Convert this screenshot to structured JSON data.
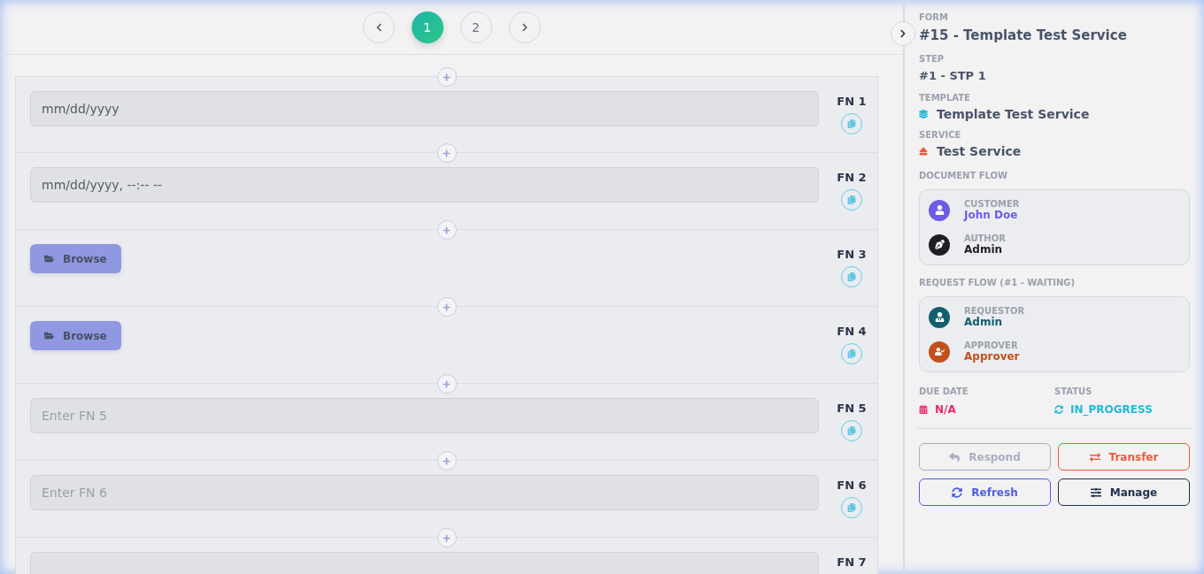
{
  "pagination": {
    "pages": [
      {
        "label": "1",
        "selected": true
      },
      {
        "label": "2",
        "selected": false
      }
    ]
  },
  "fields": [
    {
      "label": "FN 1",
      "kind": "date",
      "placeholder": "mm/dd/yyyy"
    },
    {
      "label": "FN 2",
      "kind": "datetime",
      "placeholder": "mm/dd/yyyy, --:-- --"
    },
    {
      "label": "FN 3",
      "kind": "file",
      "button": "Browse"
    },
    {
      "label": "FN 4",
      "kind": "file",
      "button": "Browse"
    },
    {
      "label": "FN 5",
      "kind": "text",
      "placeholder": "Enter FN 5"
    },
    {
      "label": "FN 6",
      "kind": "text",
      "placeholder": "Enter FN 6"
    },
    {
      "label": "FN 7",
      "kind": "text"
    }
  ],
  "details": {
    "form_label": "FORM",
    "form": "#15 - Template Test Service",
    "step_label": "STEP",
    "step": "#1 - STP 1",
    "template_label": "TEMPLATE",
    "template": "Template Test Service",
    "service_label": "SERVICE",
    "service": "Test Service",
    "document_flow": {
      "title": "DOCUMENT FLOW",
      "people": [
        {
          "kind": "customer",
          "role": "CUSTOMER",
          "name": "John Doe",
          "color": "#6c5ce7"
        },
        {
          "kind": "author",
          "role": "AUTHOR",
          "name": "Admin",
          "color": "#1e1e24"
        }
      ]
    },
    "request_flow": {
      "title": "REQUEST FLOW (#1 - WAITING)",
      "people": [
        {
          "kind": "requestor",
          "role": "REQUESTOR",
          "name": "Admin",
          "color": "#135f6d"
        },
        {
          "kind": "approver",
          "role": "APPROVER",
          "name": "Approver",
          "color": "#c2501c"
        }
      ]
    },
    "due_date_label": "DUE DATE",
    "due_date": "N/A",
    "status_label": "STATUS",
    "status": "IN_PROGRESS"
  },
  "actions": [
    {
      "kind": "respond",
      "label": "Respond",
      "disabled": true,
      "color": "#9aa3b5"
    },
    {
      "kind": "transfer",
      "label": "Transfer",
      "disabled": false,
      "color": "#ee5a3a"
    },
    {
      "kind": "refresh",
      "label": "Refresh",
      "disabled": false,
      "color": "#4f5fe0"
    },
    {
      "kind": "manage",
      "label": "Manage",
      "disabled": false,
      "color": "#1f2d4a"
    }
  ]
}
